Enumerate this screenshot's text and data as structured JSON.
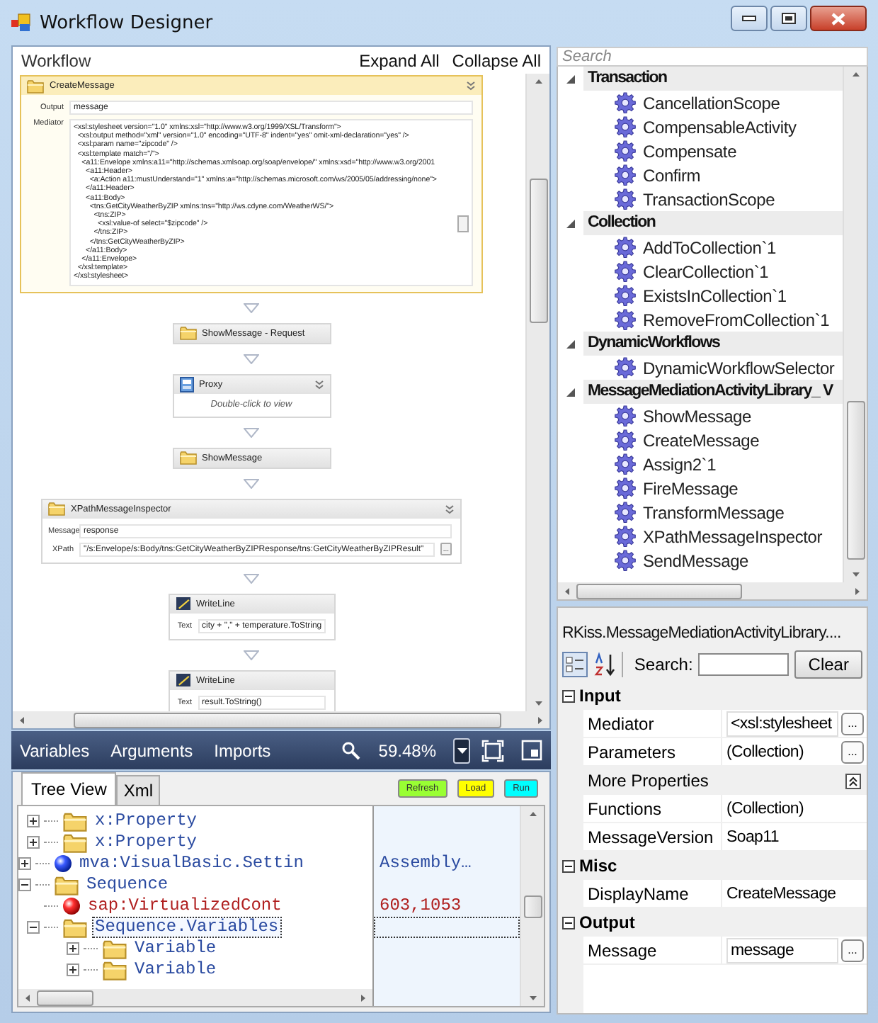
{
  "window": {
    "title": "Workflow Designer"
  },
  "designer": {
    "title": "Workflow",
    "actions": [
      "Expand All",
      "Collapse All"
    ],
    "activities": [
      {
        "kind": "mediator",
        "title": "CreateMessage",
        "selected": true,
        "collapsible": true,
        "fields": [
          {
            "kind": "text",
            "label": "Output",
            "value": "message"
          },
          {
            "kind": "multiline",
            "label": "Mediator",
            "lines": [
              "<xsl:stylesheet version=\"1.0\" xmlns:xsl=\"http://www.w3.org/1999/XSL/Transform\">",
              "  <xsl:output method=\"xml\" version=\"1.0\" encoding=\"UTF-8\" indent=\"yes\" omit-xml-declaration=\"yes\" />",
              "  <xsl:param name=\"zipcode\" />",
              "  <xsl:template match=\"/\">",
              "    <a11:Envelope xmlns:a11=\"http://schemas.xmlsoap.org/soap/envelope/\" xmlns:xsd=\"http://www.w3.org/2001",
              "      <a11:Header>",
              "        <a:Action a11:mustUnderstand=\"1\" xmlns:a=\"http://schemas.microsoft.com/ws/2005/05/addressing/none\">",
              "      </a11:Header>",
              "      <a11:Body>",
              "        <tns:GetCityWeatherByZIP xmlns:tns=\"http://ws.cdyne.com/WeatherWS/\">",
              "          <tns:ZIP>",
              "            <xsl:value-of select=\"$zipcode\" />",
              "          </tns:ZIP>",
              "        </tns:GetCityWeatherByZIP>",
              "      </a11:Body>",
              "    </a11:Envelope>",
              "  </xsl:template>",
              "</xsl:stylesheet>"
            ]
          }
        ]
      },
      {
        "kind": "simple",
        "title": "ShowMessage - Request",
        "selected": false,
        "collapsible": false
      },
      {
        "kind": "collapsed",
        "title": "Proxy",
        "selected": false,
        "collapsible": true,
        "hint": "Double-click to view"
      },
      {
        "kind": "simple",
        "title": "ShowMessage",
        "selected": false,
        "collapsible": false
      },
      {
        "kind": "inspector",
        "title": "XPathMessageInspector",
        "selected": false,
        "collapsible": true,
        "fields": [
          {
            "kind": "text",
            "label": "Message",
            "value": "response"
          },
          {
            "kind": "text",
            "label": "XPath",
            "value": "\"/s:Envelope/s:Body/tns:GetCityWeatherByZIPResponse/tns:GetCityWeatherByZIPResult\"",
            "button": "..."
          }
        ]
      },
      {
        "kind": "writeline",
        "title": "WriteLine",
        "selected": false,
        "collapsible": false,
        "fields": [
          {
            "kind": "text",
            "label": "Text",
            "value": "city + \",\" + temperature.ToString"
          }
        ]
      },
      {
        "kind": "writeline",
        "title": "WriteLine",
        "selected": false,
        "collapsible": false,
        "fields": [
          {
            "kind": "text",
            "label": "Text",
            "value": "result.ToString()"
          }
        ]
      }
    ]
  },
  "designer_bar": {
    "tabs": [
      "Variables",
      "Arguments",
      "Imports"
    ],
    "zoom": "59.48%"
  },
  "tree_panel": {
    "tabs": [
      {
        "label": "Tree View",
        "selected": true
      },
      {
        "label": "Xml",
        "selected": false
      }
    ],
    "buttons": [
      {
        "label": "Refresh",
        "color": "#99ff33"
      },
      {
        "label": "Load",
        "color": "#ffff00"
      },
      {
        "label": "Run",
        "color": "#00ffff"
      }
    ],
    "nodes": [
      {
        "children": [
          {
            "kind": "element",
            "label": "x:Property",
            "selected": false,
            "expanded": false
          },
          {
            "kind": "element",
            "label": "x:Property",
            "selected": false,
            "expanded": false
          }
        ]
      },
      {
        "kind": "setting",
        "label": "mva:VisualBasic.Settin",
        "value": "Assembly…",
        "selected": false,
        "expanded": false
      },
      {
        "kind": "element",
        "label": "Sequence",
        "selected": false,
        "expanded": true,
        "children": [
          {
            "kind": "attribute",
            "label": "sap:VirtualizedCont",
            "value": "603,1053",
            "selected": false
          },
          {
            "kind": "element",
            "label": "Sequence.Variables",
            "selected": true,
            "expanded": true,
            "children": [
              {
                "kind": "element",
                "label": "Variable",
                "selected": false,
                "expanded": false
              },
              {
                "kind": "element",
                "label": "Variable",
                "selected": false,
                "expanded": false
              }
            ]
          }
        ]
      }
    ]
  },
  "toolbox": {
    "search": {
      "placeholder": "Search"
    },
    "categories": [
      {
        "name": "Transaction",
        "expanded": true,
        "items": [
          "CancellationScope",
          "CompensableActivity",
          "Compensate",
          "Confirm",
          "TransactionScope"
        ]
      },
      {
        "name": "Collection",
        "expanded": true,
        "items": [
          "AddToCollection`1",
          "ClearCollection`1",
          "ExistsInCollection`1",
          "RemoveFromCollection`1"
        ]
      },
      {
        "name": "DynamicWorkflows",
        "expanded": true,
        "items": [
          "DynamicWorkflowSelector"
        ]
      },
      {
        "name": "MessageMediationActivityLibrary_ V",
        "expanded": true,
        "items": [
          "ShowMessage",
          "CreateMessage",
          "Assign2`1",
          "FireMessage",
          "TransformMessage",
          "XPathMessageInspector",
          "SendMessage"
        ]
      }
    ]
  },
  "properties": {
    "title": "RKiss.MessageMediationActivityLibrary....",
    "search_label": "Search:",
    "clear": "Clear",
    "categories": [
      {
        "name": "Input",
        "expanded": true,
        "rows": [
          {
            "kind": "property",
            "name": "Mediator",
            "value": "<xsl:stylesheet",
            "boxed": true,
            "button": "..."
          },
          {
            "kind": "property",
            "name": "Parameters",
            "value": "(Collection)",
            "boxed": false,
            "button": "..."
          },
          {
            "kind": "subheader",
            "name": "More Properties",
            "expanded": true
          },
          {
            "kind": "property",
            "name": "Functions",
            "value": "(Collection)",
            "boxed": false
          },
          {
            "kind": "property",
            "name": "MessageVersion",
            "value": "Soap11",
            "boxed": false
          }
        ]
      },
      {
        "name": "Misc",
        "expanded": true,
        "rows": [
          {
            "kind": "property",
            "name": "DisplayName",
            "value": "CreateMessage",
            "boxed": false
          }
        ]
      },
      {
        "name": "Output",
        "expanded": true,
        "rows": [
          {
            "kind": "property",
            "name": "Message",
            "value": "message",
            "boxed": true,
            "button": "..."
          }
        ]
      }
    ]
  }
}
